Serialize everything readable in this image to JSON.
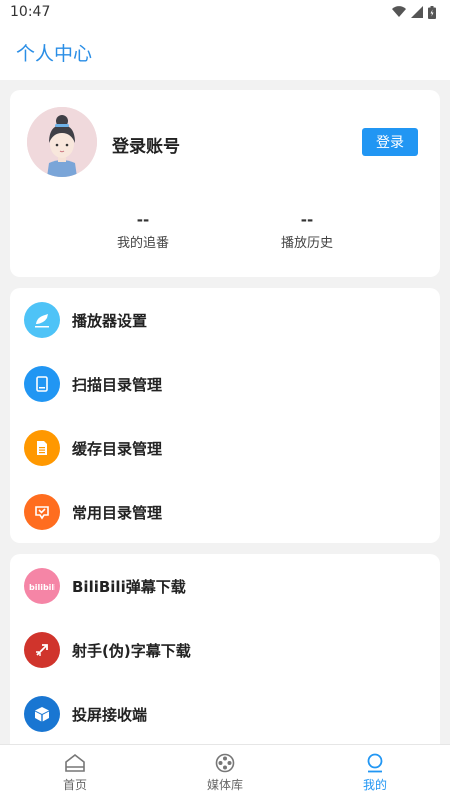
{
  "status_bar": {
    "time": "10:47"
  },
  "header": {
    "title": "个人中心"
  },
  "profile": {
    "login_name": "登录账号",
    "login_button": "登录",
    "stats": [
      {
        "value": "--",
        "label": "我的追番"
      },
      {
        "value": "--",
        "label": "播放历史"
      }
    ]
  },
  "menu_group_1": [
    {
      "label": "播放器设置",
      "icon": "player-settings-icon",
      "color": "#4ec3f7"
    },
    {
      "label": "扫描目录管理",
      "icon": "scan-folder-icon",
      "color": "#2196f3"
    },
    {
      "label": "缓存目录管理",
      "icon": "cache-folder-icon",
      "color": "#ff9800"
    },
    {
      "label": "常用目录管理",
      "icon": "common-folder-icon",
      "color": "#ff6d1f"
    }
  ],
  "menu_group_2": [
    {
      "label": "BiliBili弹幕下载",
      "icon": "bilibili-icon",
      "color": "#f585a6"
    },
    {
      "label": "射手(伪)字幕下载",
      "icon": "shooter-subtitle-icon",
      "color": "#d0342c"
    },
    {
      "label": "投屏接收端",
      "icon": "cast-receiver-icon",
      "color": "#1976d2"
    }
  ],
  "bottom_nav": [
    {
      "label": "首页",
      "icon": "home-icon"
    },
    {
      "label": "媒体库",
      "icon": "media-library-icon"
    },
    {
      "label": "我的",
      "icon": "user-icon",
      "active": true
    }
  ]
}
